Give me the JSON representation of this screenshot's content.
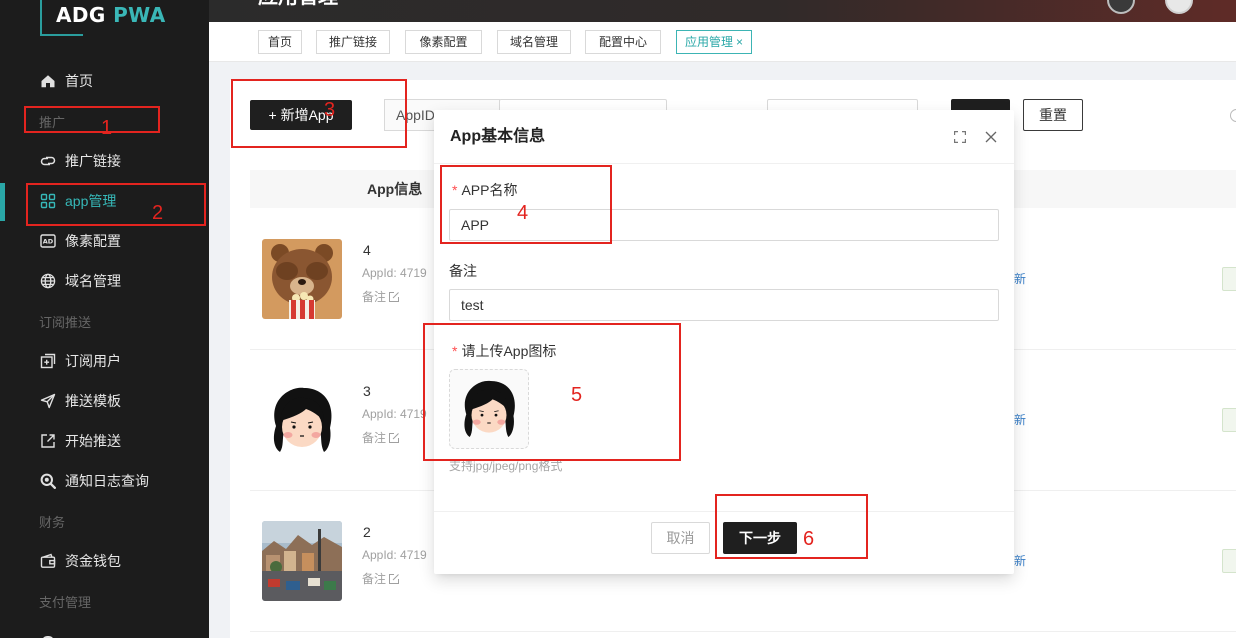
{
  "logo": {
    "part1": "ADG",
    "part2": "PWA"
  },
  "header": {
    "title": "应用管理"
  },
  "sidebar": {
    "items": [
      {
        "label": "首页",
        "icon": "home-icon"
      },
      {
        "label": "推广",
        "section": true
      },
      {
        "label": "推广链接",
        "icon": "link-icon"
      },
      {
        "label": "app管理",
        "icon": "grid-icon",
        "active": true
      },
      {
        "label": "像素配置",
        "icon": "ad-icon",
        "icon_text": "AD"
      },
      {
        "label": "域名管理",
        "icon": "globe-icon"
      },
      {
        "label": "订阅推送",
        "section": true
      },
      {
        "label": "订阅用户",
        "icon": "add-square-icon"
      },
      {
        "label": "推送模板",
        "icon": "send-icon"
      },
      {
        "label": "开始推送",
        "icon": "open-external-icon"
      },
      {
        "label": "通知日志查询",
        "icon": "zoom-search-icon"
      },
      {
        "label": "财务",
        "section": true
      },
      {
        "label": "资金钱包",
        "icon": "wallet-icon"
      },
      {
        "label": "支付管理",
        "section": true
      }
    ]
  },
  "tabs": {
    "items": [
      {
        "label": "首页"
      },
      {
        "label": "推广链接"
      },
      {
        "label": "像素配置"
      },
      {
        "label": "域名管理"
      },
      {
        "label": "配置中心"
      },
      {
        "label": "应用管理",
        "active": true
      }
    ],
    "close": "×"
  },
  "toolbar": {
    "add_button": "+ 新增App",
    "appid_addon": "AppID",
    "reset_button": "重置"
  },
  "table": {
    "header_app_info": "App信息",
    "rows": [
      {
        "name": "4",
        "appid": "AppId: 4719",
        "remark": "备注",
        "action": "新"
      },
      {
        "name": "3",
        "appid": "AppId: 4719",
        "remark": "备注",
        "action": "新"
      },
      {
        "name": "2",
        "appid": "AppId: 4719",
        "remark": "备注",
        "action": "新"
      }
    ]
  },
  "modal": {
    "title": "App基本信息",
    "required_mark": "*",
    "app_name_label": "APP名称",
    "app_name_value": "APP",
    "remark_label": "备注",
    "remark_value": "test",
    "icon_label": "请上传App图标",
    "icon_hint": "支持jpg/jpeg/png格式",
    "cancel_button": "取消",
    "next_button": "下一步"
  },
  "annotations": [
    "1",
    "2",
    "3",
    "4",
    "5",
    "6"
  ],
  "colors": {
    "accent": "#2aa7a7",
    "primary_dark": "#1f1f1f",
    "sidebar_bg": "#1c1c1c",
    "annotation_red": "#e3241f",
    "required": "#ff4d4f",
    "link": "#3a80c9"
  }
}
